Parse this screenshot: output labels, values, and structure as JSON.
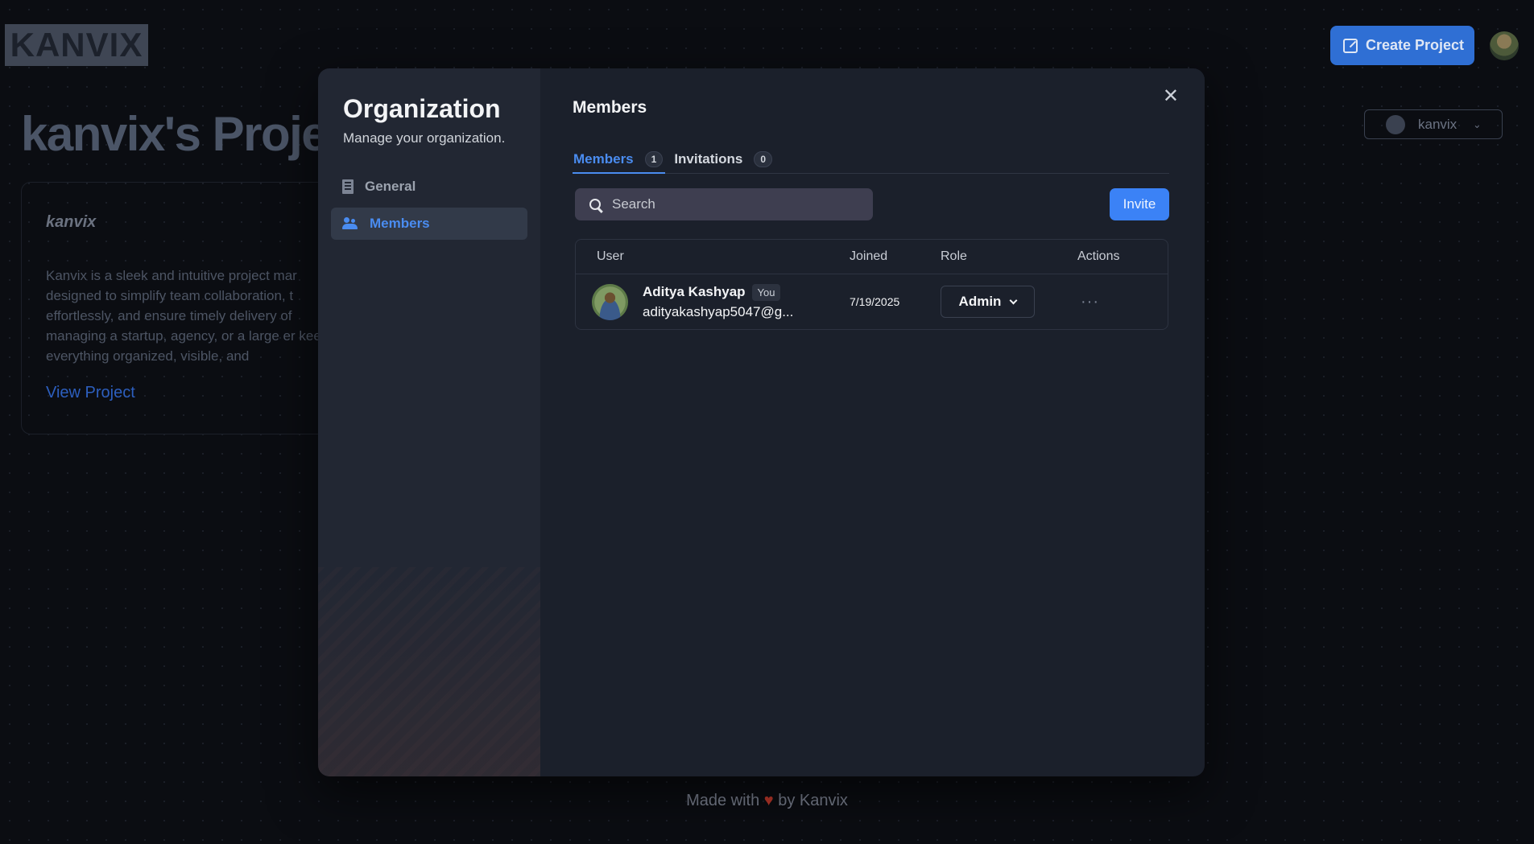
{
  "background": {
    "logo": "KANVIX",
    "create_project_label": "Create Project",
    "page_title": "kanvix's Proje",
    "org_switcher": "kanvix",
    "project_card": {
      "name": "kanvix",
      "description": "Kanvix is a sleek and intuitive project mar designed to simplify team collaboration, t effortlessly, and ensure timely delivery of managing a startup, agency, or a large er keeps everything organized, visible, and",
      "link": "View Project"
    },
    "footer": {
      "prefix": "Made with",
      "heart": "♥",
      "suffix": "by Kanvix"
    }
  },
  "modal": {
    "sidebar": {
      "title": "Organization",
      "subtitle": "Manage your organization.",
      "items": [
        {
          "label": "General",
          "icon": "building-icon",
          "active": false
        },
        {
          "label": "Members",
          "icon": "users-icon",
          "active": true
        }
      ]
    },
    "main": {
      "title": "Members",
      "close_glyph": "✕",
      "tabs": [
        {
          "label": "Members",
          "count": "1",
          "active": true
        },
        {
          "label": "Invitations",
          "count": "0",
          "active": false
        }
      ],
      "search_placeholder": "Search",
      "invite_label": "Invite",
      "table": {
        "headers": {
          "user": "User",
          "joined": "Joined",
          "role": "Role",
          "actions": "Actions"
        },
        "rows": [
          {
            "name": "Aditya Kashyap",
            "badge": "You",
            "email": "adityakashyap5047@g...",
            "joined": "7/19/2025",
            "role": "Admin",
            "actions": "···"
          }
        ]
      }
    }
  },
  "colors": {
    "accent": "#3b82f6",
    "active_text": "#4a8cf0",
    "modal_main_bg": "#1b202b",
    "modal_side_bg": "#222733"
  }
}
